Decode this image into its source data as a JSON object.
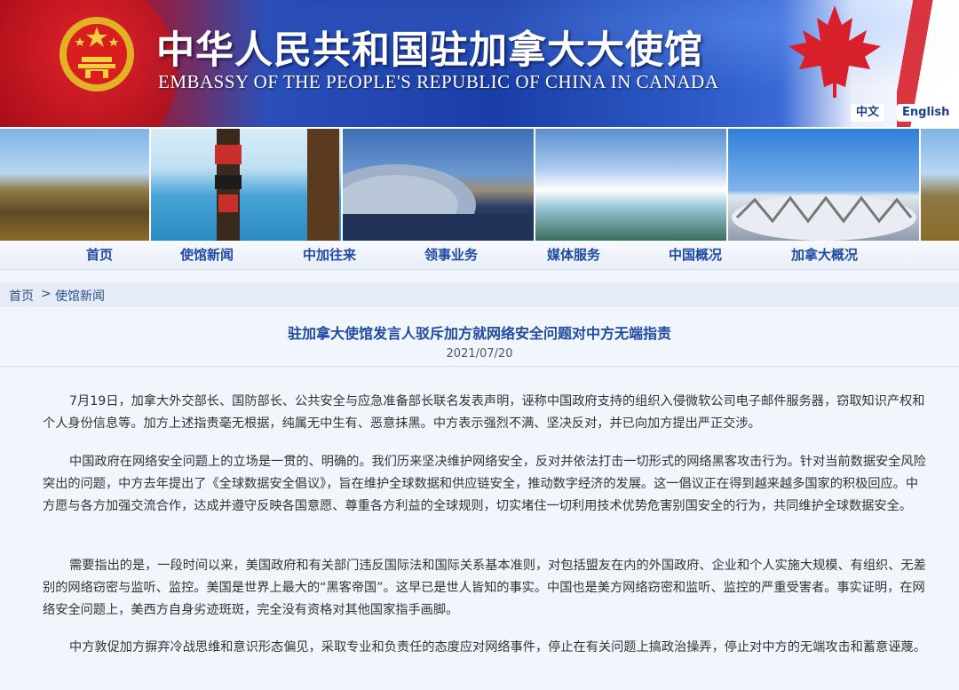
{
  "header": {
    "title_cn": "中华人民共和国驻加拿大大使馆",
    "title_en": "EMBASSY OF THE PEOPLE'S REPUBLIC OF CHINA IN CANADA",
    "lang_cn": "中文",
    "lang_en": "English"
  },
  "nav": {
    "items": [
      "首页",
      "使馆新闻",
      "中加往来",
      "领事业务",
      "媒体服务",
      "中国概况",
      "加拿大概况"
    ]
  },
  "breadcrumb": {
    "home": "首页",
    "separator": ">",
    "current": "使馆新闻"
  },
  "article": {
    "title": "驻加拿大使馆发言人驳斥加方就网络安全问题对中方无端指责",
    "date": "2021/07/20",
    "paragraphs": [
      "7月19日，加拿大外交部长、国防部长、公共安全与应急准备部长联名发表声明，诬称中国政府支持的组织入侵微软公司电子邮件服务器，窃取知识产权和个人身份信息等。加方上述指责毫无根据，纯属无中生有、恶意抹黑。中方表示强烈不满、坚决反对，并已向加方提出严正交涉。",
      "中国政府在网络安全问题上的立场是一贯的、明确的。我们历来坚决维护网络安全，反对并依法打击一切形式的网络黑客攻击行为。针对当前数据安全风险突出的问题，中方去年提出了《全球数据安全倡议》，旨在维护全球数据和供应链安全，推动数字经济的发展。这一倡议正在得到越来越多国家的积极回应。中方愿与各方加强交流合作，达成并遵守反映各国意愿、尊重各方利益的全球规则，切实堵住一切利用技术优势危害别国安全的行为，共同维护全球数据安全。",
      "需要指出的是，一段时间以来，美国政府和有关部门违反国际法和国际关系基本准则，对包括盟友在内的外国政府、企业和个人实施大规模、有组织、无差别的网络窃密与监听、监控。美国是世界上最大的“黑客帝国”。这早已是世人皆知的事实。中国也是美方网络窃密和监听、监控的严重受害者。事实证明，在网络安全问题上，美西方自身劣迹斑斑，完全没有资格对其他国家指手画脚。",
      "中方敦促加方摒弃冷战思维和意识形态偏见，采取专业和负责任的态度应对网络事件，停止在有关问题上搞政治操弄，停止对中方的无端攻击和蓄意诬蔑。"
    ]
  },
  "colors": {
    "banner_blue": "#1a3ea8",
    "nav_text": "#1f4aa3",
    "page_bg": "#f1f6fc"
  }
}
